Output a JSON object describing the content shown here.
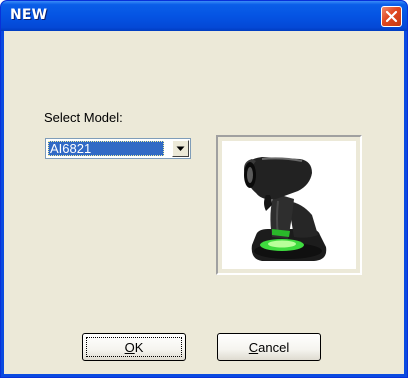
{
  "window": {
    "title": "NEW"
  },
  "form": {
    "select_label": "Select Model:",
    "model_value": "AI6821"
  },
  "buttons": {
    "ok_mnemonic": "O",
    "ok_rest": "K",
    "cancel_mnemonic": "C",
    "cancel_rest": "ancel"
  },
  "icons": {
    "close": "close-x-icon",
    "dropdown": "dropdown-arrow-icon",
    "product": "barcode-scanner-image"
  },
  "colors": {
    "titlebar": "#0554e3",
    "close_button": "#e0461e",
    "dialog_bg": "#ece9d8",
    "selection": "#316ac5"
  }
}
